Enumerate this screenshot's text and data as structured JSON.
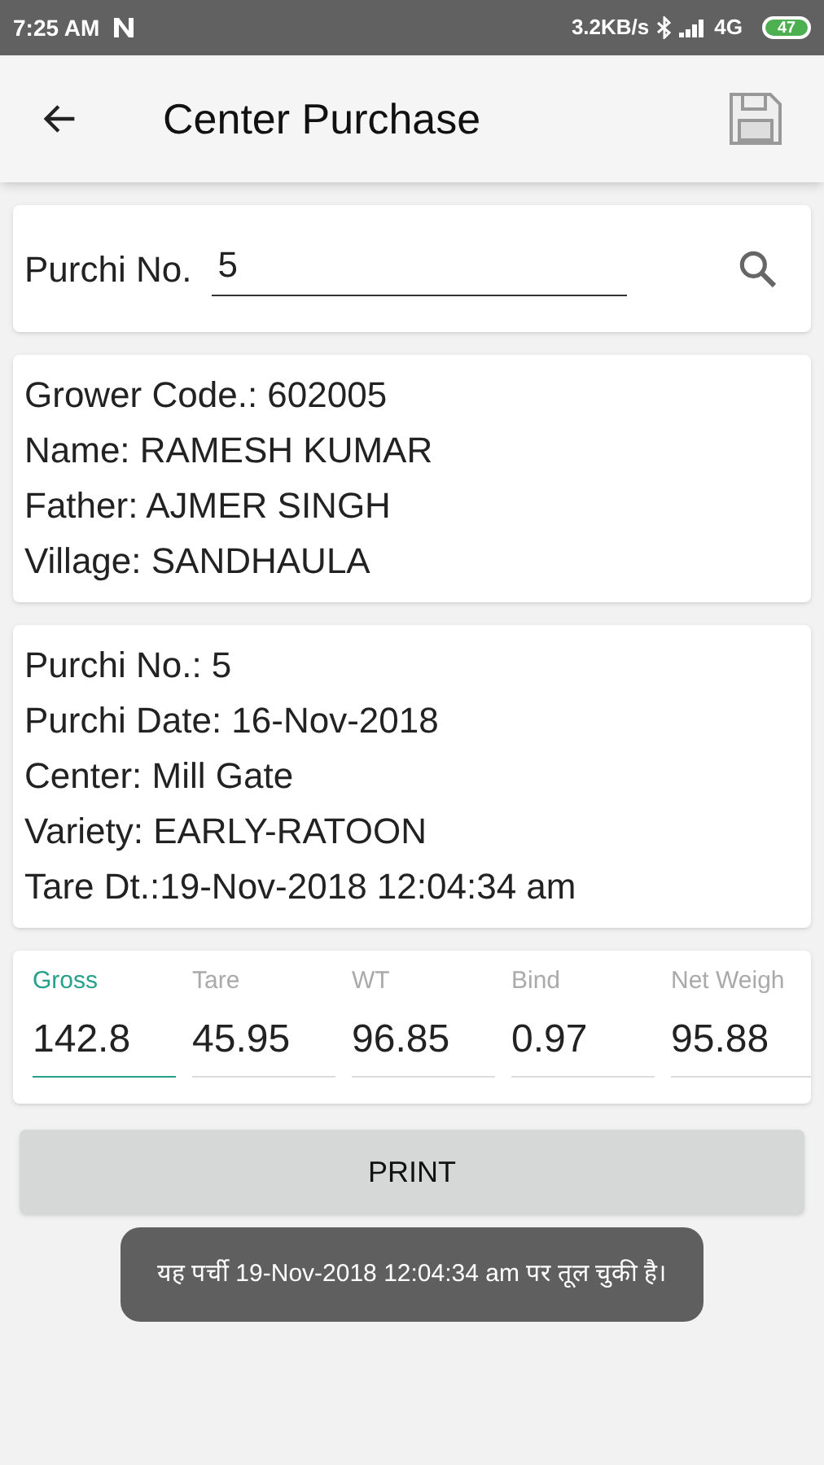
{
  "status_bar": {
    "time": "7:25 AM",
    "speed": "3.2KB/s",
    "network": "4G",
    "battery": "47"
  },
  "app_bar": {
    "title": "Center Purchase"
  },
  "search": {
    "label": "Purchi No.",
    "value": "5"
  },
  "grower": [
    "Grower Code.: 602005",
    "Name: RAMESH KUMAR",
    "Father: AJMER SINGH",
    "Village: SANDHAULA"
  ],
  "purchi": [
    "Purchi No.: 5",
    "Purchi Date: 16-Nov-2018",
    "Center: Mill Gate",
    "Variety: EARLY-RATOON",
    "Tare Dt.:19-Nov-2018 12:04:34 am"
  ],
  "weights": [
    {
      "label": "Gross",
      "value": "142.8",
      "focused": true
    },
    {
      "label": "Tare",
      "value": "45.95",
      "focused": false
    },
    {
      "label": "WT",
      "value": "96.85",
      "focused": false
    },
    {
      "label": "Bind",
      "value": "0.97",
      "focused": false
    },
    {
      "label": "Net Weigh",
      "value": "95.88",
      "focused": false
    }
  ],
  "print_button": "PRINT",
  "toast": "यह पर्ची 19-Nov-2018 12:04:34 am पर तूल  चुकी है।"
}
